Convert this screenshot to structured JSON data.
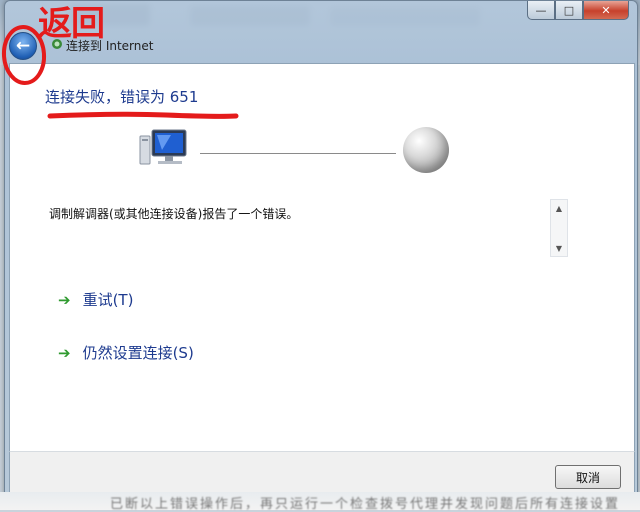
{
  "window": {
    "title": "连接到 Internet",
    "minimize_glyph": "—",
    "maximize_glyph": "□",
    "close_glyph": "✕",
    "back_glyph": "←"
  },
  "main": {
    "heading": "连接失败，错误为 651",
    "message": "调制解调器(或其他连接设备)报告了一个错误。",
    "scroll_up_glyph": "▲",
    "scroll_down_glyph": "▼",
    "options": [
      {
        "label": "重试(T)",
        "icon": "green-arrow-icon",
        "arrow": "➔"
      },
      {
        "label": "仍然设置连接(S)",
        "icon": "green-arrow-icon",
        "arrow": "➔"
      }
    ]
  },
  "footer": {
    "cancel_label": "取消"
  },
  "annotation": {
    "label": "返回",
    "color": "#e41b1b"
  },
  "background": {
    "bottom_text": "已断以上错误操作后，再只运行一个检查拨号代理并发现问题后所有连接设置"
  },
  "colors": {
    "link_blue": "#1e3b8f",
    "arrow_green": "#2f9a2f"
  }
}
